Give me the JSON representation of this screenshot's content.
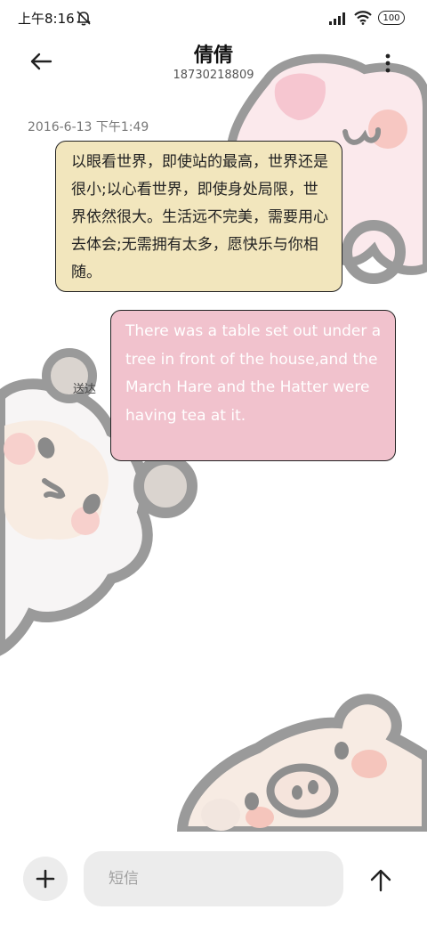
{
  "status_bar": {
    "time": "上午8:16",
    "battery": "100",
    "icons": [
      "mute-icon",
      "signal-icon",
      "wifi-icon",
      "battery-icon"
    ]
  },
  "header": {
    "back_icon": "back-arrow-icon",
    "contact_name": "倩倩",
    "contact_number": "18730218809",
    "more_icon": "more-vertical-icon"
  },
  "conversation": {
    "timestamp": "2016-6-13 下午1:49",
    "messages": [
      {
        "direction": "incoming",
        "text": "以眼看世界，即使站的最高，世界还是很小;以心看世界，即使身处局限，世界依然很大。生活远不完美，需要用心去体会;无需拥有太多，愿快乐与你相随。"
      },
      {
        "direction": "outgoing",
        "text": "There was a table set out under a tree in front of the house,and the March Hare and the Hatter were having tea at it.",
        "status": "送达"
      }
    ]
  },
  "composer": {
    "add_icon": "plus-icon",
    "placeholder": "短信",
    "value": "",
    "send_icon": "send-arrow-icon"
  },
  "colors": {
    "incoming_bubble": "#f2e6bd",
    "outgoing_bubble": "#f1c2cd",
    "outline": "#222222",
    "background": "#ffffff"
  }
}
